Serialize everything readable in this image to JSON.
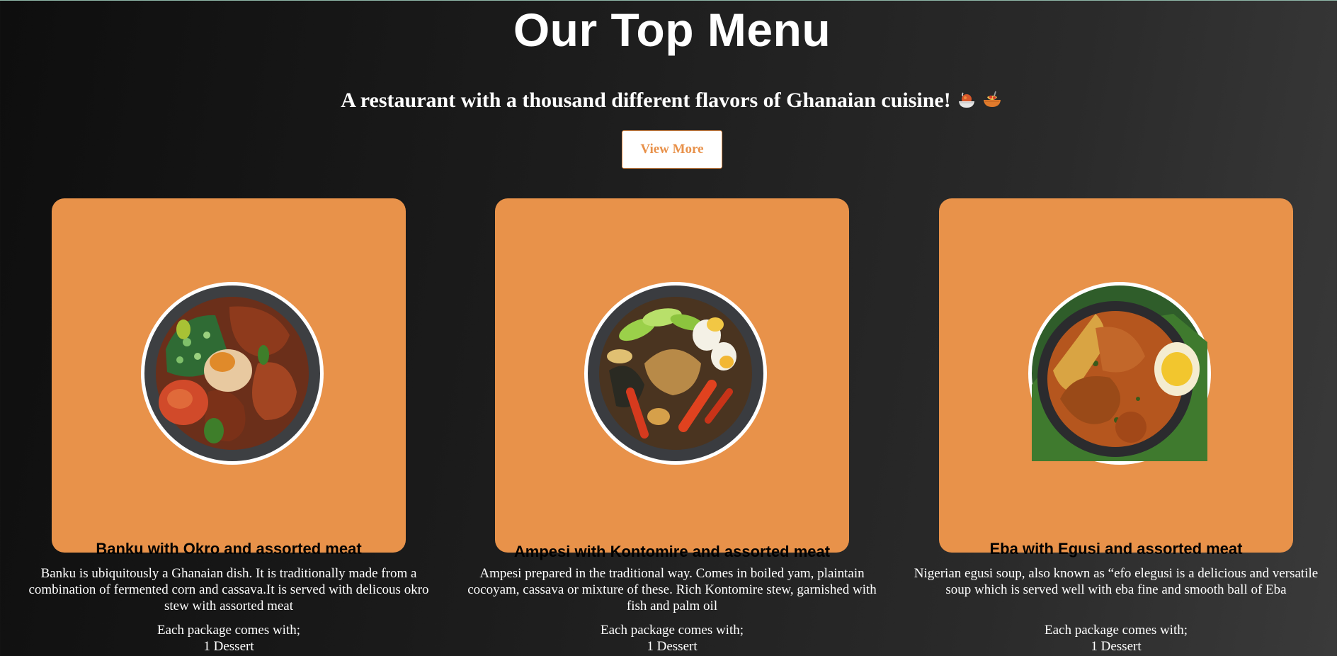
{
  "header": {
    "title": "Our Top Menu",
    "subtitle": "A restaurant with a thousand different flavors of Ghanaian cuisine!",
    "subtitle_icons": [
      "soup-bowl-icon",
      "spaghetti-icon"
    ],
    "view_more_label": "View More"
  },
  "colors": {
    "accent": "#e8924a",
    "background_dark": "#111111",
    "background_light": "#3a3a3a",
    "text": "#ffffff",
    "card_title": "#000000"
  },
  "menu": {
    "items": [
      {
        "title": "Banku with Okro and assorted meat",
        "description": "Banku is ubiquitously a Ghanaian dish. It is traditionally made from a combination of fermented corn and cassava.It is served with delicous okro stew with assorted meat",
        "package_label": "Each package comes with;",
        "dessert": "1 Dessert",
        "image": "banku-okro-dish-image"
      },
      {
        "title": "Ampesi with Kontomire and assorted meat",
        "description": "Ampesi prepared in the traditional way. Comes in boiled yam, plaintain cocoyam, cassava or mixture of these. Rich Kontomire stew, garnished with fish and palm oil",
        "package_label": "Each package comes with;",
        "dessert": "1 Dessert",
        "image": "ampesi-kontomire-dish-image"
      },
      {
        "title": "Eba with Egusi and assorted meat",
        "description": "Nigerian egusi soup, also known as “efo elegusi is a delicious and versatile soup which is served well with eba fine and smooth ball of Eba",
        "package_label": "Each package comes with;",
        "dessert": "1 Dessert",
        "image": "eba-egusi-dish-image"
      }
    ]
  }
}
